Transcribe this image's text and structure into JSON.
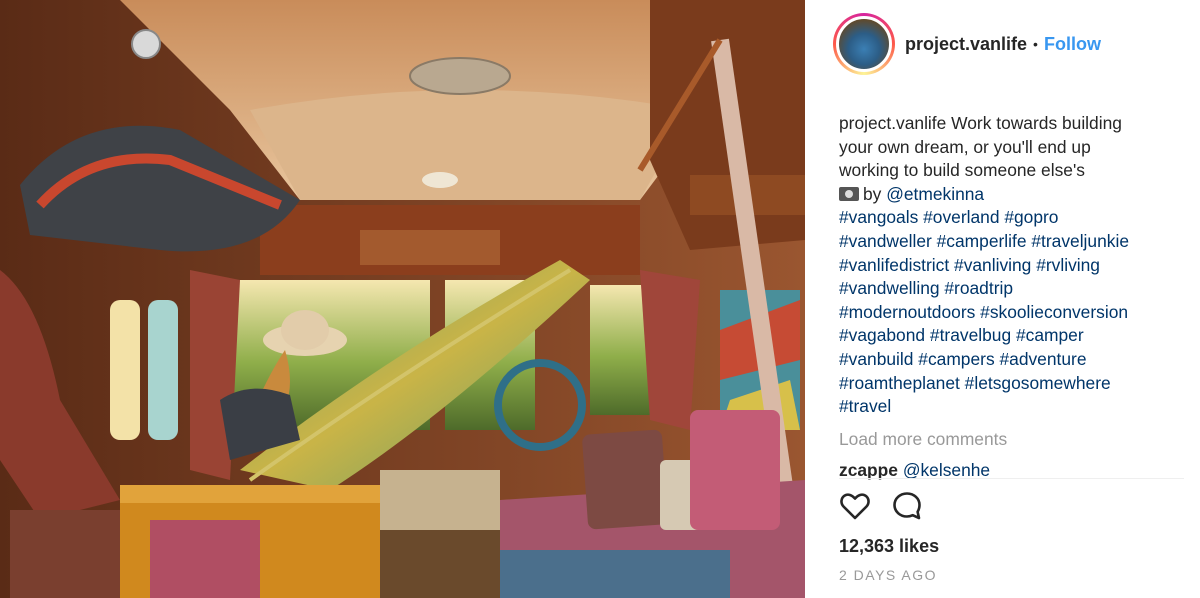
{
  "header": {
    "username": "project.vanlife",
    "dot": "•",
    "follow_label": "Follow",
    "avatar_icon": "profile-avatar"
  },
  "caption": {
    "username": "project.vanlife",
    "text_line1": "Work towards building",
    "text_line2": "your own dream, or you'll end up",
    "text_line3": "working to build someone else's",
    "credit_icon": "camera-emoji",
    "credit_prefix": "by",
    "credit_handle": "@etmekinna",
    "hashtag_lines": [
      "#vangoals #overland #gopro",
      "#vandweller #camperlife #traveljunkie",
      "#vanlifedistrict #vanliving #rvliving",
      "#vandwelling #roadtrip",
      "#modernoutdoors #skoolieconversion",
      "#vagabond #travelbug #camper",
      "#vanbuild #campers #adventure",
      "#roamtheplanet #letsgosomewhere",
      "#travel"
    ]
  },
  "load_more": "Load more comments",
  "comment": {
    "username": "zcappe",
    "text": "@kelsenhe"
  },
  "actions": {
    "like_icon": "heart-icon",
    "comment_icon": "comment-bubble-icon"
  },
  "likes": "12,363 likes",
  "time": "2 DAYS AGO",
  "colors": {
    "link_blue": "#3897f0",
    "hashtag_navy": "#003569",
    "muted_gray": "#999999"
  }
}
